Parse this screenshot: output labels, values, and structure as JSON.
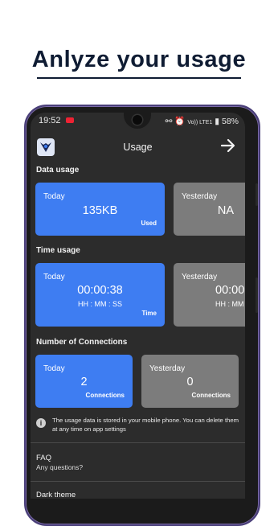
{
  "headline": "Anlyze your usage",
  "status_bar": {
    "time": "19:52",
    "signal_text": "Vo)) LTE1",
    "battery": "58%"
  },
  "app_bar": {
    "title": "Usage"
  },
  "data_usage": {
    "heading": "Data usage",
    "today": {
      "label": "Today",
      "value": "135KB",
      "tag": "Used"
    },
    "yesterday": {
      "label": "Yesterday",
      "value": "NA"
    }
  },
  "time_usage": {
    "heading": "Time usage",
    "today": {
      "label": "Today",
      "value": "00:00:38",
      "format": "HH : MM : SS",
      "tag": "Time"
    },
    "yesterday": {
      "label": "Yesterday",
      "value": "00:00",
      "format": "HH : MM :"
    }
  },
  "connections": {
    "heading": "Number of Connections",
    "today": {
      "label": "Today",
      "value": "2",
      "tag": "Connections"
    },
    "yesterday": {
      "label": "Yesterday",
      "value": "0",
      "tag": "Connections"
    }
  },
  "info": {
    "icon": "info-icon",
    "text": "The usage data is stored in your mobile phone. You can delete them at any time on app settings"
  },
  "faq": {
    "title": "FAQ",
    "subtitle": "Any questions?"
  },
  "next_item": "Dark theme",
  "colors": {
    "accent": "#3e7df2",
    "card_grey": "#7c7c7c",
    "screen_bg": "#2c2c2c",
    "headline": "#0f1c33"
  }
}
